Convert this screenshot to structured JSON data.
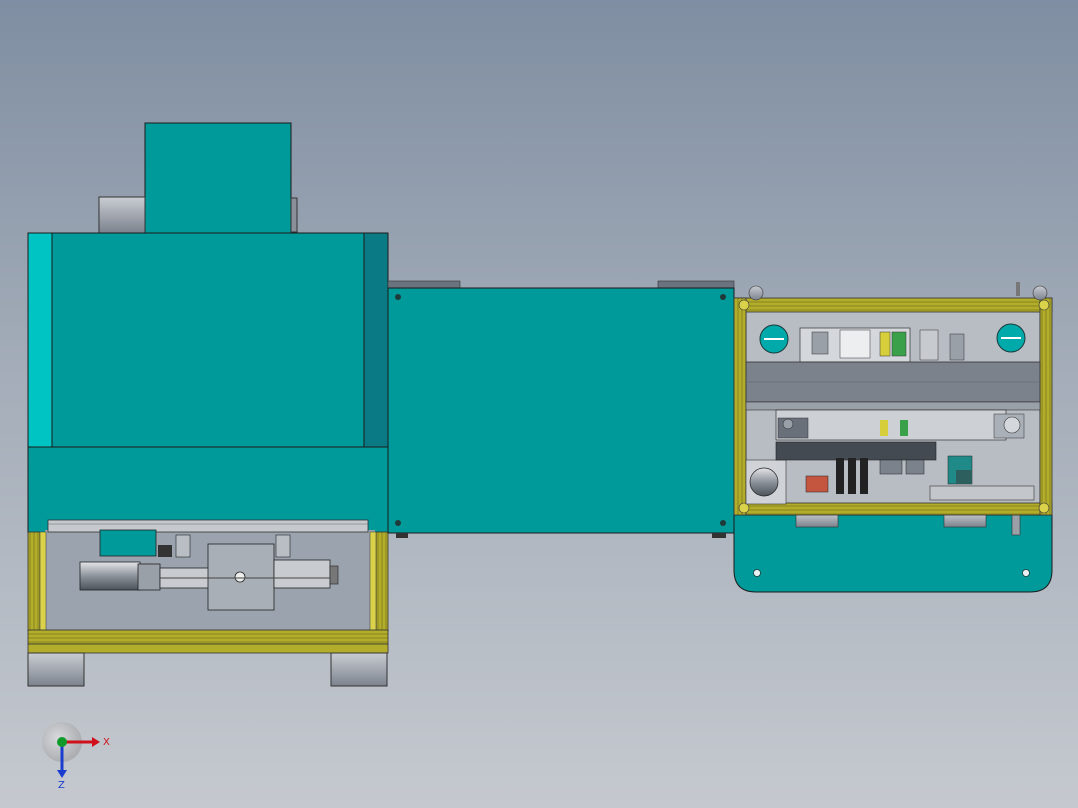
{
  "triad": {
    "x_label": "X",
    "z_label": "Z"
  },
  "colors": {
    "teal": "#009a9a",
    "teal_light": "#00c3c3",
    "teal_dark": "#0a7b84",
    "yellow_frame": "#b3ad2c",
    "steel_gray": "#7c838e",
    "background_top": "#7f8ea2",
    "background_bottom": "#c5c9cf",
    "axis_x": "#d0101a",
    "axis_y": "#0f9a2a",
    "axis_z": "#1a3dd0"
  },
  "icons": {
    "view_triad": "coordinate-triad-icon"
  }
}
